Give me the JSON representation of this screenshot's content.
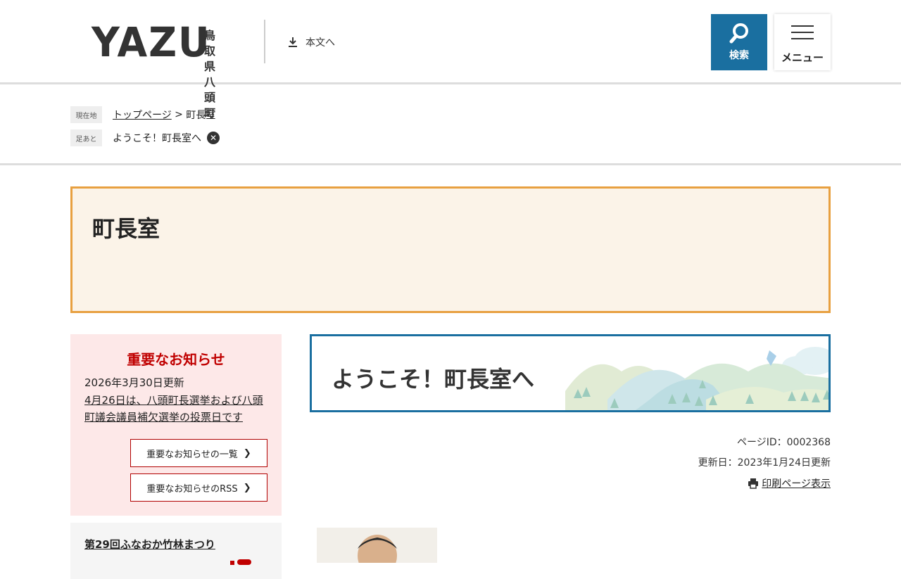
{
  "header": {
    "logo_main": "YAZU",
    "logo_sub_line1": "鳥取県",
    "logo_sub_line2": "八頭町",
    "skip_link": "本文へ",
    "search_label": "検索",
    "menu_label": "メニュー",
    "accent_color": "#1a6fa0"
  },
  "breadcrumb": {
    "current_tag": "現在地",
    "home_link": "トップページ",
    "separator": " > ",
    "current": "町長室",
    "history_tag": "足あと",
    "history_item": "ようこそ！町長室へ"
  },
  "page_title": "町長室",
  "sidebar": {
    "notice_title": "重要なお知らせ",
    "notice_date": "2026年3月30日更新",
    "notice_item": "4月26日は、八頭町長選挙および八頭町議会議員補欠選挙の投票日です",
    "list_button": "重要なお知らせの一覧",
    "rss_button": "重要なお知らせのRSS",
    "event_link": "第29回ふなおか竹林まつり"
  },
  "main": {
    "banner_title": "ようこそ！町長室へ",
    "page_id": "ページID：0002368",
    "updated": "更新日：2023年1月24日更新",
    "print_link": "印刷ページ表示"
  }
}
